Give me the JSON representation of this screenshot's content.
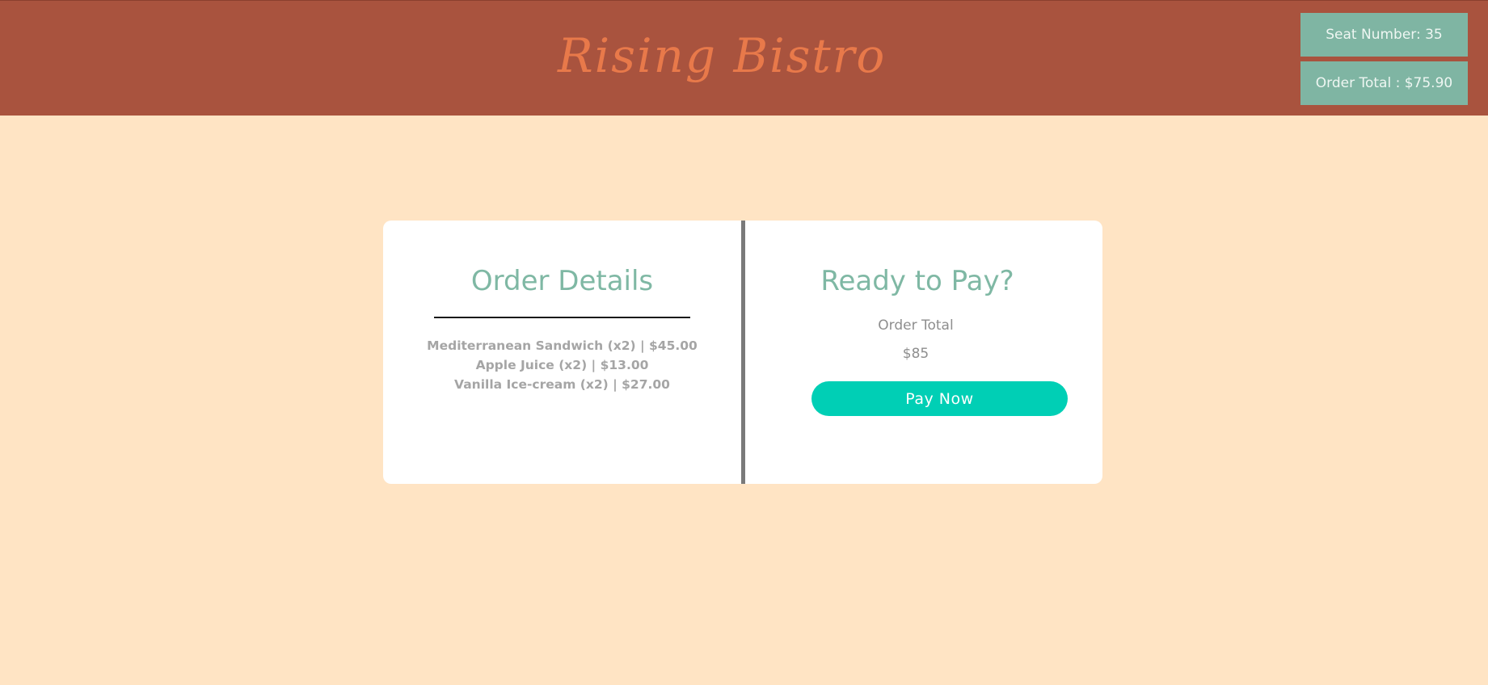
{
  "header": {
    "brand": "Rising Bistro",
    "seat_label": "Seat Number: 35",
    "order_total_label": "Order Total : $75.90"
  },
  "order_details": {
    "title": "Order Details",
    "items": [
      "Mediterranean Sandwich (x2) | $45.00",
      "Apple Juice (x2) | $13.00",
      "Vanilla Ice-cream (x2) | $27.00"
    ]
  },
  "payment": {
    "title": "Ready to Pay?",
    "total_label": "Order Total",
    "total_value": "$85",
    "pay_button": "Pay Now"
  },
  "colors": {
    "header_bg": "#a9533e",
    "brand": "#e8794a",
    "page_bg": "#ffe4c4",
    "info_box_bg": "#7fb5a3",
    "accent_teal": "#00cfb5",
    "title_green": "#7fb8a4"
  }
}
